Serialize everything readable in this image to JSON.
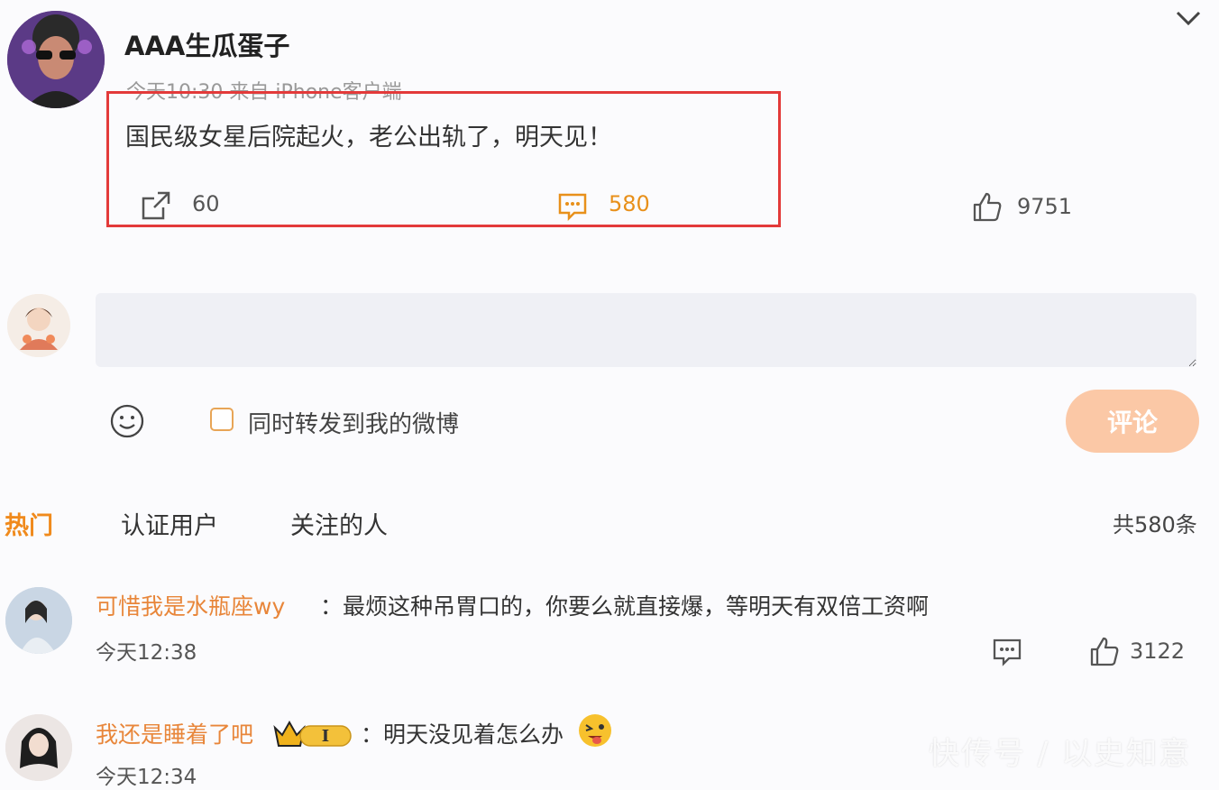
{
  "post": {
    "username": "AAA生瓜蛋子",
    "meta": "今天10:30 来自 iPhone客户端",
    "text": "国民级女星后院起火，老公出轨了，明天见！",
    "repost_count": "60",
    "comment_count": "580",
    "like_count": "9751"
  },
  "composer": {
    "placeholder": "",
    "also_repost_label": "同时转发到我的微博",
    "submit_label": "评论"
  },
  "tabs": {
    "hot": "热门",
    "verified": "认证用户",
    "following": "关注的人",
    "total": "共580条"
  },
  "comments": [
    {
      "user": "可惜我是水瓶座wy",
      "text": "：最烦这种吊胃口的，你要么就直接爆，等明天有双倍工资啊",
      "time": "今天12:38",
      "likes": "3122"
    },
    {
      "user": "我还是睡着了吧",
      "badge": "I",
      "text": "：明天没见着怎么办",
      "time": "今天12:34"
    }
  ],
  "watermark": "快传号 / 以史知意",
  "colors": {
    "accent_orange": "#f08a1c",
    "highlight_red": "#e33a3a",
    "button_peach": "#fbc8a6"
  }
}
